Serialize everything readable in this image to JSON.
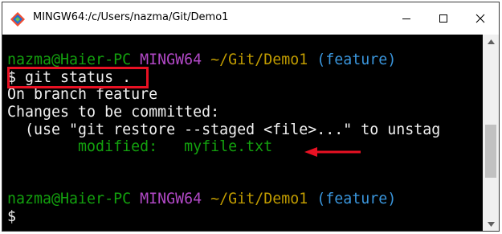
{
  "window": {
    "title": "MINGW64:/c/Users/nazma/Git/Demo1"
  },
  "titlebar": {
    "icons": [
      "git-bash-icon",
      "minimize-icon",
      "maximize-icon",
      "close-icon"
    ]
  },
  "terminal": {
    "prompt1": {
      "user": "nazma@Haier-PC",
      "host": "MINGW64",
      "path": "~/Git/Demo1",
      "branch": "(feature)"
    },
    "command": "$ git status .",
    "output": {
      "line1": "On branch feature",
      "line2": "Changes to be committed:",
      "line3": "  (use \"git restore --staged <file>...\" to unstag",
      "status_label": "        modified:   myfile.txt"
    },
    "prompt2": {
      "user": "nazma@Haier-PC",
      "host": "MINGW64",
      "path": "~/Git/Demo1",
      "branch": "(feature)"
    },
    "cursor_prompt": "$"
  },
  "colors": {
    "user": "#13a10e",
    "host": "#b148c6",
    "path": "#c19c00",
    "branch": "#3a96dd",
    "annotation": "#e81123",
    "terminal_bg": "#000000"
  }
}
